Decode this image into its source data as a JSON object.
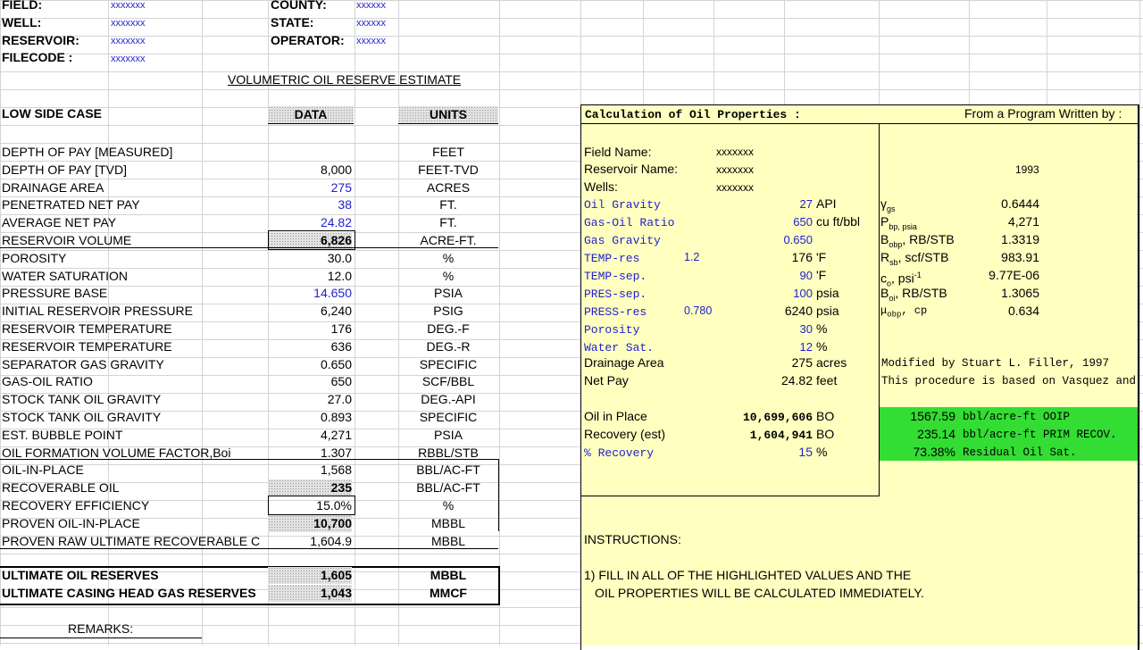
{
  "header": {
    "field_label": "FIELD:",
    "field_value": "xxxxxxx",
    "well_label": "WELL:",
    "well_value": "xxxxxxx",
    "reservoir_label": "RESERVOIR:",
    "reservoir_value": "xxxxxxx",
    "filecode_label": "FILECODE :",
    "filecode_value": "xxxxxxx",
    "county_label": "COUNTY:",
    "county_value": "xxxxxx",
    "state_label": "STATE:",
    "state_value": "xxxxxx",
    "operator_label": "OPERATOR:",
    "operator_value": "xxxxxx"
  },
  "title": "VOLUMETRIC OIL RESERVE ESTIMATE",
  "case_label": "LOW SIDE CASE",
  "col_data": "DATA",
  "col_units": "UNITS",
  "rows": [
    {
      "label": "DEPTH OF PAY [MEASURED]",
      "value": "",
      "unit": "FEET"
    },
    {
      "label": "DEPTH OF PAY [TVD]",
      "value": "8,000",
      "unit": "FEET-TVD"
    },
    {
      "label": "DRAINAGE AREA",
      "value": "275",
      "unit": "ACRES"
    },
    {
      "label": "PENETRATED NET PAY",
      "value": "38",
      "unit": "FT."
    },
    {
      "label": "AVERAGE NET PAY",
      "value": "24.82",
      "unit": "FT."
    },
    {
      "label": "RESERVOIR VOLUME",
      "value": "6,826",
      "unit": "ACRE-FT."
    },
    {
      "label": "POROSITY",
      "value": "30.0",
      "unit": "%"
    },
    {
      "label": "WATER SATURATION",
      "value": "12.0",
      "unit": "%"
    },
    {
      "label": "PRESSURE BASE",
      "value": "14.650",
      "unit": "PSIA"
    },
    {
      "label": "INITIAL RESERVOIR PRESSURE",
      "value": "6,240",
      "unit": "PSIG"
    },
    {
      "label": "RESERVOIR TEMPERATURE",
      "value": "176",
      "unit": "DEG.-F"
    },
    {
      "label": "RESERVOIR TEMPERATURE",
      "value": "636",
      "unit": "DEG.-R"
    },
    {
      "label": "SEPARATOR GAS GRAVITY",
      "value": "0.650",
      "unit": "SPECIFIC"
    },
    {
      "label": "GAS-OIL RATIO",
      "value": "650",
      "unit": "SCF/BBL"
    },
    {
      "label": "STOCK TANK OIL GRAVITY",
      "value": "27.0",
      "unit": "DEG.-API"
    },
    {
      "label": "STOCK TANK OIL GRAVITY",
      "value": "0.893",
      "unit": "SPECIFIC"
    },
    {
      "label": "EST. BUBBLE POINT",
      "value": "4,271",
      "unit": "PSIA"
    },
    {
      "label": "OIL FORMATION VOLUME FACTOR,Boi",
      "value": "1.307",
      "unit": "RBBL/STB"
    },
    {
      "label": "OIL-IN-PLACE",
      "value": "1,568",
      "unit": "BBL/AC-FT"
    },
    {
      "label": "RECOVERABLE OIL",
      "value": "235",
      "unit": "BBL/AC-FT"
    },
    {
      "label": "RECOVERY EFFICIENCY",
      "value": "15.0%",
      "unit": "%"
    },
    {
      "label": "PROVEN OIL-IN-PLACE",
      "value": "10,700",
      "unit": "MBBL"
    },
    {
      "label": "PROVEN RAW ULTIMATE RECOVERABLE C",
      "value": "1,604.9",
      "unit": "MBBL"
    }
  ],
  "ultimate": [
    {
      "label": "ULTIMATE OIL RESERVES",
      "value": "1,605",
      "unit": "MBBL"
    },
    {
      "label": "ULTIMATE CASING HEAD GAS RESERVES",
      "value": "1,043",
      "unit": "MMCF"
    }
  ],
  "remarks": "REMARKS:",
  "props": {
    "title": "Calculation of Oil Properties :",
    "from": "From a Program Written by :",
    "year": "1993",
    "field_name_label": "Field Name:",
    "field_name": "xxxxxxx",
    "reservoir_name_label": "Reservoir Name:",
    "reservoir_name": "xxxxxxx",
    "wells_label": "Wells:",
    "wells": "xxxxxxx",
    "inputs": [
      {
        "label": "Oil Gravity",
        "extra": "",
        "value": "27",
        "unit": "API"
      },
      {
        "label": "Gas-Oil Ratio",
        "extra": "",
        "value": "650",
        "unit": "cu ft/bbl"
      },
      {
        "label": "Gas Gravity",
        "extra": "",
        "value": "0.650",
        "unit": ""
      },
      {
        "label": "TEMP-res",
        "extra": "1.2",
        "value": "176",
        "unit": "'F"
      },
      {
        "label": "TEMP-sep.",
        "extra": "",
        "value": "90",
        "unit": "'F"
      },
      {
        "label": "PRES-sep.",
        "extra": "",
        "value": "100",
        "unit": "psia"
      },
      {
        "label": "PRESS-res",
        "extra": "0.780",
        "value": "6240",
        "unit": "psia"
      },
      {
        "label": "Porosity",
        "extra": "",
        "value": "30",
        "unit": "%"
      },
      {
        "label": "Water Sat.",
        "extra": "",
        "value": "12",
        "unit": "%"
      }
    ],
    "drainage_label": "Drainage Area",
    "drainage_value": "275",
    "drainage_unit": "acres",
    "netpay_label": "Net Pay",
    "netpay_value": "24.82",
    "netpay_unit": "feet",
    "oip_label": "Oil in Place",
    "oip_value": "10,699,606",
    "oip_unit": "BO",
    "rec_label": "Recovery (est)",
    "rec_value": "1,604,941",
    "rec_unit": "BO",
    "pct_label": "% Recovery",
    "pct_value": "15",
    "pct_unit": "%",
    "results": [
      {
        "symbol": "γ",
        "sub": "gs",
        "sup": "",
        "rest": "",
        "value": "0.6444"
      },
      {
        "symbol": "P",
        "sub": "bp, psia",
        "sup": "",
        "rest": "",
        "value": "4,271"
      },
      {
        "symbol": "B",
        "sub": "obp",
        "sup": "",
        "rest": ", RB/STB",
        "value": "1.3319"
      },
      {
        "symbol": "R",
        "sub": "sb",
        "sup": "",
        "rest": ", scf/STB",
        "value": "983.91"
      },
      {
        "symbol": "c",
        "sub": "o",
        "sup": "-1",
        "rest": ", psi",
        "value": "9.77E-06"
      },
      {
        "symbol": "B",
        "sub": "oi",
        "sup": "",
        "rest": ", RB/STB",
        "value": "1.3065"
      },
      {
        "symbol": "μ",
        "sub": "obp",
        "sup": "",
        "rest": ", cp",
        "value": "0.634"
      }
    ],
    "modified": "Modified by Stuart L. Filler, 1997",
    "procedure": "This procedure is based on Vasquez and",
    "green": [
      {
        "value": "1567.59",
        "text": "bbl/acre-ft OOIP"
      },
      {
        "value": "235.14",
        "text": "bbl/acre-ft PRIM RECOV."
      },
      {
        "value": "73.38%",
        "text": "Residual Oil Sat."
      }
    ],
    "instructions_title": "INSTRUCTIONS:",
    "instruction_1": "1) FILL IN ALL OF THE HIGHLIGHTED VALUES AND THE",
    "instruction_2": "OIL PROPERTIES WILL BE CALCULATED IMMEDIATELY."
  }
}
